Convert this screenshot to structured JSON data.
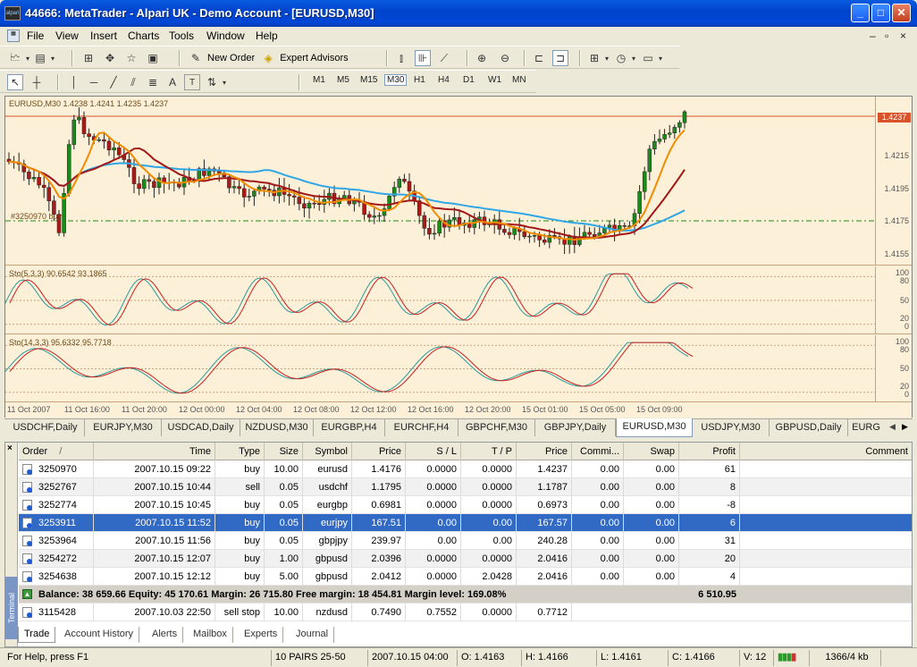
{
  "window": {
    "title": "44666: MetaTrader - Alpari UK - Demo Account - [EURUSD,M30]",
    "app_icon_text": "alpari"
  },
  "menu": [
    "File",
    "View",
    "Insert",
    "Charts",
    "Tools",
    "Window",
    "Help"
  ],
  "toolbar": {
    "new_order": "New Order",
    "expert_advisors": "Expert Advisors"
  },
  "drawing_toolbar": {
    "text_tool": "A",
    "label_tool": "T"
  },
  "timeframes": [
    "M1",
    "M5",
    "M15",
    "M30",
    "H1",
    "H4",
    "D1",
    "W1",
    "MN"
  ],
  "selected_timeframe": "M30",
  "chart": {
    "header": "EURUSD,M30  1.4238 1.4241 1.4235 1.4237",
    "order_label": "#3250970 buy",
    "price_scale": [
      "1.4215",
      "1.4195",
      "1.4175",
      "1.4155"
    ],
    "current_price": "1.4237",
    "stoch1_header": "Sto(5,3,3) 90.6542 93.1865",
    "stoch1_scale": [
      "100",
      "80",
      "50",
      "20",
      "0"
    ],
    "stoch2_header": "Sto(14,3,3) 95.6332 95.7718",
    "stoch2_scale": [
      "100",
      "80",
      "50",
      "20",
      "0"
    ],
    "time_labels": [
      "11 Oct 2007",
      "11 Oct 16:00",
      "11 Oct 20:00",
      "12 Oct 00:00",
      "12 Oct 04:00",
      "12 Oct 08:00",
      "12 Oct 12:00",
      "12 Oct 16:00",
      "12 Oct 20:00",
      "15 Oct 01:00",
      "15 Oct 05:00",
      "15 Oct 09:00"
    ],
    "colors": {
      "bg": "#fdf0d8",
      "bull": "#1a8a1a",
      "bear": "#b01818",
      "ma_fast": "#f08c00",
      "ma_slow": "#a01818",
      "ma_long": "#2fa6e6"
    }
  },
  "symbol_tabs": [
    "USDCHF,Daily",
    "EURJPY,M30",
    "USDCAD,Daily",
    "NZDUSD,M30",
    "EURGBP,H4",
    "EURCHF,H4",
    "GBPCHF,M30",
    "GBPJPY,Daily",
    "EURUSD,M30",
    "USDJPY,M30",
    "GBPUSD,Daily",
    "EURG"
  ],
  "selected_symbol_tab": "EURUSD,M30",
  "terminal": {
    "close": "×",
    "side_label": "Terminal",
    "columns": [
      "Order",
      "/",
      "Time",
      "Type",
      "Size",
      "Symbol",
      "Price",
      "S / L",
      "T / P",
      "Price",
      "Commi...",
      "Swap",
      "Profit",
      "Comment"
    ],
    "orders": [
      {
        "order": "3250970",
        "time": "2007.10.15 09:22",
        "type": "buy",
        "size": "10.00",
        "symbol": "eurusd",
        "price": "1.4176",
        "sl": "0.0000",
        "tp": "0.0000",
        "cur": "1.4237",
        "comm": "0.00",
        "swap": "0.00",
        "profit": "61"
      },
      {
        "order": "3252767",
        "time": "2007.10.15 10:44",
        "type": "sell",
        "size": "0.05",
        "symbol": "usdchf",
        "price": "1.1795",
        "sl": "0.0000",
        "tp": "0.0000",
        "cur": "1.1787",
        "comm": "0.00",
        "swap": "0.00",
        "profit": "8"
      },
      {
        "order": "3252774",
        "time": "2007.10.15 10:45",
        "type": "buy",
        "size": "0.05",
        "symbol": "eurgbp",
        "price": "0.6981",
        "sl": "0.0000",
        "tp": "0.0000",
        "cur": "0.6973",
        "comm": "0.00",
        "swap": "0.00",
        "profit": "-8"
      },
      {
        "order": "3253911",
        "time": "2007.10.15 11:52",
        "type": "buy",
        "size": "0.05",
        "symbol": "eurjpy",
        "price": "167.51",
        "sl": "0.00",
        "tp": "0.00",
        "cur": "167.57",
        "comm": "0.00",
        "swap": "0.00",
        "profit": "6"
      },
      {
        "order": "3253964",
        "time": "2007.10.15 11:56",
        "type": "buy",
        "size": "0.05",
        "symbol": "gbpjpy",
        "price": "239.97",
        "sl": "0.00",
        "tp": "0.00",
        "cur": "240.28",
        "comm": "0.00",
        "swap": "0.00",
        "profit": "31"
      },
      {
        "order": "3254272",
        "time": "2007.10.15 12:07",
        "type": "buy",
        "size": "1.00",
        "symbol": "gbpusd",
        "price": "2.0396",
        "sl": "0.0000",
        "tp": "0.0000",
        "cur": "2.0416",
        "comm": "0.00",
        "swap": "0.00",
        "profit": "20"
      },
      {
        "order": "3254638",
        "time": "2007.10.15 12:12",
        "type": "buy",
        "size": "5.00",
        "symbol": "gbpusd",
        "price": "2.0412",
        "sl": "0.0000",
        "tp": "2.0428",
        "cur": "2.0416",
        "comm": "0.00",
        "swap": "0.00",
        "profit": "4"
      }
    ],
    "selected_row": 3,
    "balance_line": "Balance: 38 659.66  Equity: 45 170.61  Margin: 26 715.80  Free margin: 18 454.81  Margin level: 169.08%",
    "balance_profit": "6 510.95",
    "pending": {
      "order": "3115428",
      "time": "2007.10.03 22:50",
      "type": "sell stop",
      "size": "10.00",
      "symbol": "nzdusd",
      "price": "0.7490",
      "sl": "0.7552",
      "tp": "0.0000",
      "cur": "0.7712"
    },
    "tabs": [
      "Trade",
      "Account History",
      "Alerts",
      "Mailbox",
      "Experts",
      "Journal"
    ],
    "selected_tab": "Trade"
  },
  "status": {
    "help": "For Help, press F1",
    "profile": "10 PAIRS 25-50",
    "time": "2007.10.15 04:00",
    "open": "O: 1.4163",
    "high": "H: 1.4166",
    "low": "L: 1.4161",
    "close": "C: 1.4166",
    "volume": "V: 12",
    "traffic": "1366/4 kb"
  }
}
